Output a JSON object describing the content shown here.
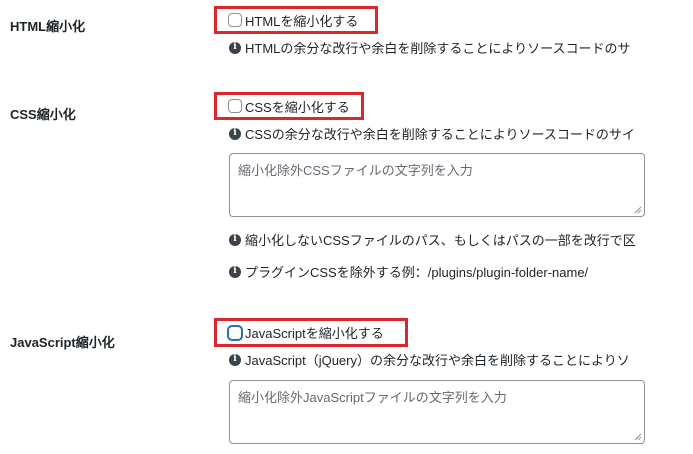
{
  "html_section": {
    "label": "HTML縮小化",
    "checkbox_label": "HTMLを縮小化する",
    "checked": false,
    "description": "HTMLの余分な改行や余白を削除することによりソースコードのサ"
  },
  "css_section": {
    "label": "CSS縮小化",
    "checkbox_label": "CSSを縮小化する",
    "checked": false,
    "description": "CSSの余分な改行や余白を削除することによりソースコードのサイ",
    "exclude_placeholder": "縮小化除外CSSファイルの文字列を入力",
    "note_exclude": "縮小化しないCSSファイルのパス、もしくはパスの一部を改行で区",
    "note_example": "プラグインCSSを除外する例：/plugins/plugin-folder-name/"
  },
  "js_section": {
    "label": "JavaScript縮小化",
    "checkbox_label": "JavaScriptを縮小化する",
    "checked": false,
    "description": "JavaScript（jQuery）の余分な改行や余白を削除することによりソ",
    "exclude_placeholder": "縮小化除外JavaScriptファイルの文字列を入力"
  },
  "colors": {
    "highlight_border": "#d9272e",
    "focus_accent": "#2271b1"
  },
  "icons": {
    "info": "info-circle-icon",
    "resize": "resize-grip-icon"
  }
}
